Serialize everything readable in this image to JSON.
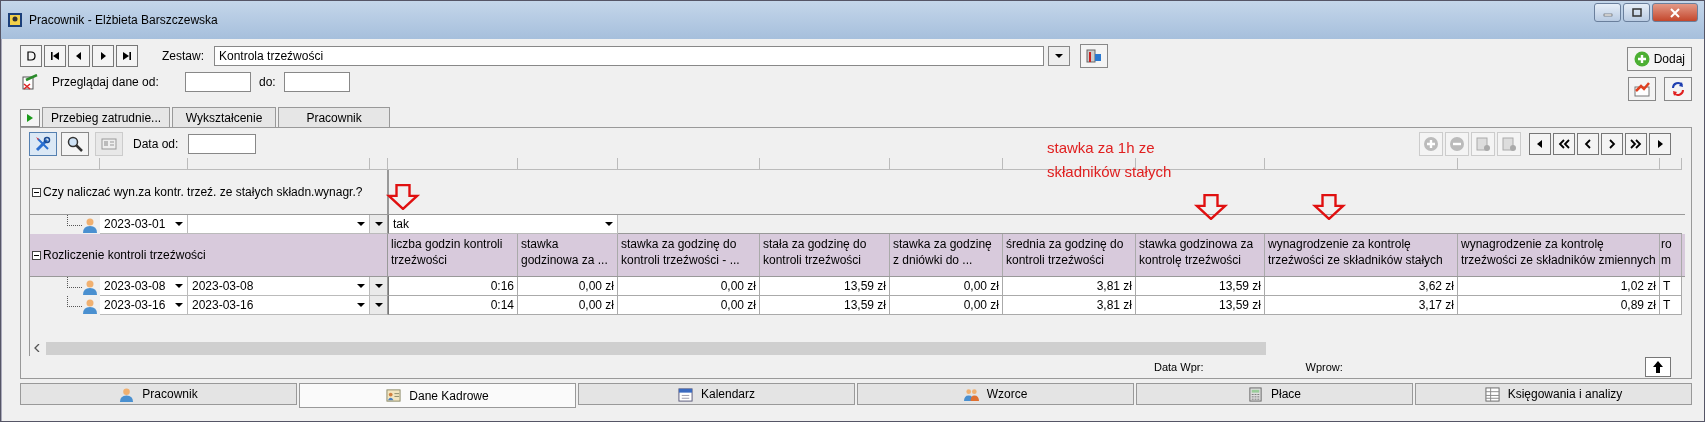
{
  "window": {
    "title": "Pracownik - Elżbieta Barszczewska"
  },
  "zestaw": {
    "label": "Zestaw:",
    "value": "Kontrola trzeźwości"
  },
  "browse": {
    "label": "Przeglądaj dane od:",
    "to_label": "do:"
  },
  "add_button": "Dodaj",
  "tabs": [
    {
      "label": "Przebieg zatrudnie...",
      "selected": false
    },
    {
      "label": "Wykształcenie",
      "selected": false
    },
    {
      "label": "Pracownik",
      "selected": false
    }
  ],
  "grid_toolbar": {
    "date_label": "Data od:"
  },
  "groups": [
    {
      "title": "Czy naliczać wyn.za kontr. trzeź. ze stałych składn.wynagr.?",
      "expanded": true,
      "rows": [
        {
          "date_from": "2023-03-01",
          "value": "tak"
        }
      ]
    },
    {
      "title": "Rozliczenie kontroli trzeźwości",
      "expanded": true,
      "columns": [
        "liczba godzin kontroli trzeźwości",
        "stawka godzinowa za ...",
        "stawka za godzinę do kontroli trzeźwości - ...",
        "stała za godzinę do kontroli trzeźwości",
        "stawka za godzinę z dniówki do ...",
        "średnia za godzinę do kontroli trzeźwości",
        "stawka godzinowa za kontrolę trzeźwości",
        "wynagrodzenie za kontrolę trzeźwości ze składników stałych",
        "wynagrodzenie za kontrolę trzeźwości ze składników zmiennych",
        "ro m"
      ],
      "rows": [
        {
          "date_from": "2023-03-08",
          "date_to": "2023-03-08",
          "cells": [
            "0:16",
            "0,00 zł",
            "0,00 zł",
            "13,59 zł",
            "0,00 zł",
            "3,81 zł",
            "13,59 zł",
            "3,62 zł",
            "1,02 zł",
            "T"
          ]
        },
        {
          "date_from": "2023-03-16",
          "date_to": "2023-03-16",
          "cells": [
            "0:14",
            "0,00 zł",
            "0,00 zł",
            "13,59 zł",
            "0,00 zł",
            "3,81 zł",
            "13,59 zł",
            "3,17 zł",
            "0,89 zł",
            "T"
          ]
        }
      ]
    }
  ],
  "annotation": {
    "text": "stawka za 1h ze składników stałych"
  },
  "footer": {
    "date_label": "Data Wpr:",
    "by_label": "Wprow:"
  },
  "bottom_tabs": [
    {
      "label": "Pracownik",
      "selected": false
    },
    {
      "label": "Dane Kadrowe",
      "selected": true
    },
    {
      "label": "Kalendarz",
      "selected": false
    },
    {
      "label": "Wzorce",
      "selected": false
    },
    {
      "label": "Płace",
      "selected": false
    },
    {
      "label": "Księgowania i analizy",
      "selected": false
    }
  ]
}
